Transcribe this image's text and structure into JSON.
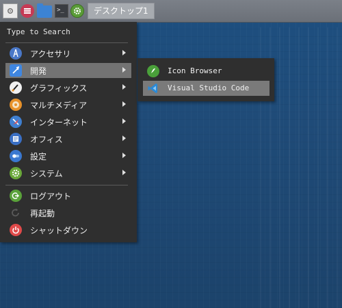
{
  "taskbar": {
    "workspace_label": "デスクトップ1",
    "launchers": [
      "show-desktop-icon",
      "app-menu-icon",
      "file-manager-icon",
      "terminal-icon",
      "settings-icon"
    ]
  },
  "app_menu": {
    "search_placeholder": "Type to Search",
    "categories": [
      {
        "label": "アクセサリ",
        "icon": "accessories-icon",
        "color": "#4a78c8"
      },
      {
        "label": "開発",
        "icon": "development-icon",
        "color": "#3f86e0"
      },
      {
        "label": "グラフィックス",
        "icon": "graphics-icon",
        "color": "#f1f1f1"
      },
      {
        "label": "マルチメディア",
        "icon": "multimedia-icon",
        "color": "#e8922a"
      },
      {
        "label": "インターネット",
        "icon": "internet-icon",
        "color": "#3f7fd0"
      },
      {
        "label": "オフィス",
        "icon": "office-icon",
        "color": "#3a6fc4"
      },
      {
        "label": "設定",
        "icon": "preferences-icon",
        "color": "#3a78d0"
      },
      {
        "label": "システム",
        "icon": "system-icon",
        "color": "#6aa83a"
      }
    ],
    "actions": [
      {
        "label": "ログアウト",
        "icon": "logout-icon",
        "color": "#5aa23a"
      },
      {
        "label": "再起動",
        "icon": "restart-icon",
        "color": "#4a4a4a"
      },
      {
        "label": "シャットダウン",
        "icon": "shutdown-icon",
        "color": "#e04a4a"
      }
    ]
  },
  "submenu": {
    "items": [
      {
        "label": "Icon Browser",
        "icon": "icon-browser-icon",
        "color": "#4aa03a"
      },
      {
        "label": "Visual Studio Code",
        "icon": "vscode-icon",
        "color": "#2a8ad8"
      }
    ]
  }
}
